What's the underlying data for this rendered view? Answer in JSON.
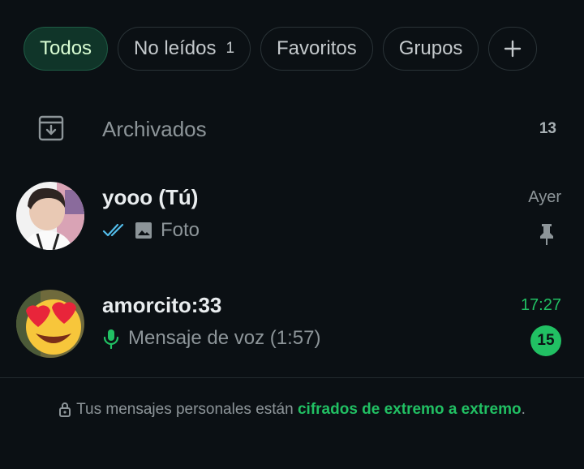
{
  "filters": [
    {
      "label": "Todos",
      "active": true
    },
    {
      "label": "No leídos",
      "count": "1"
    },
    {
      "label": "Favoritos"
    },
    {
      "label": "Grupos"
    }
  ],
  "archived": {
    "label": "Archivados",
    "count": "13",
    "icon": "archive-icon"
  },
  "chats": [
    {
      "name": "yooo (Tú)",
      "time": "Ayer",
      "preview": "Foto",
      "status_icon": "double-check-icon",
      "media_icon": "image-icon",
      "pinned": true
    },
    {
      "name": "amorcito:33",
      "time": "17:27",
      "preview": "Mensaje de voz (1:57)",
      "media_icon": "mic-icon",
      "unread": "15"
    }
  ],
  "footer": {
    "text": "Tus mensajes personales están",
    "link": "cifrados de extremo a extremo",
    "suffix": "."
  },
  "colors": {
    "accent": "#21c063",
    "background": "#0b1014",
    "chip_active": "#103529"
  }
}
